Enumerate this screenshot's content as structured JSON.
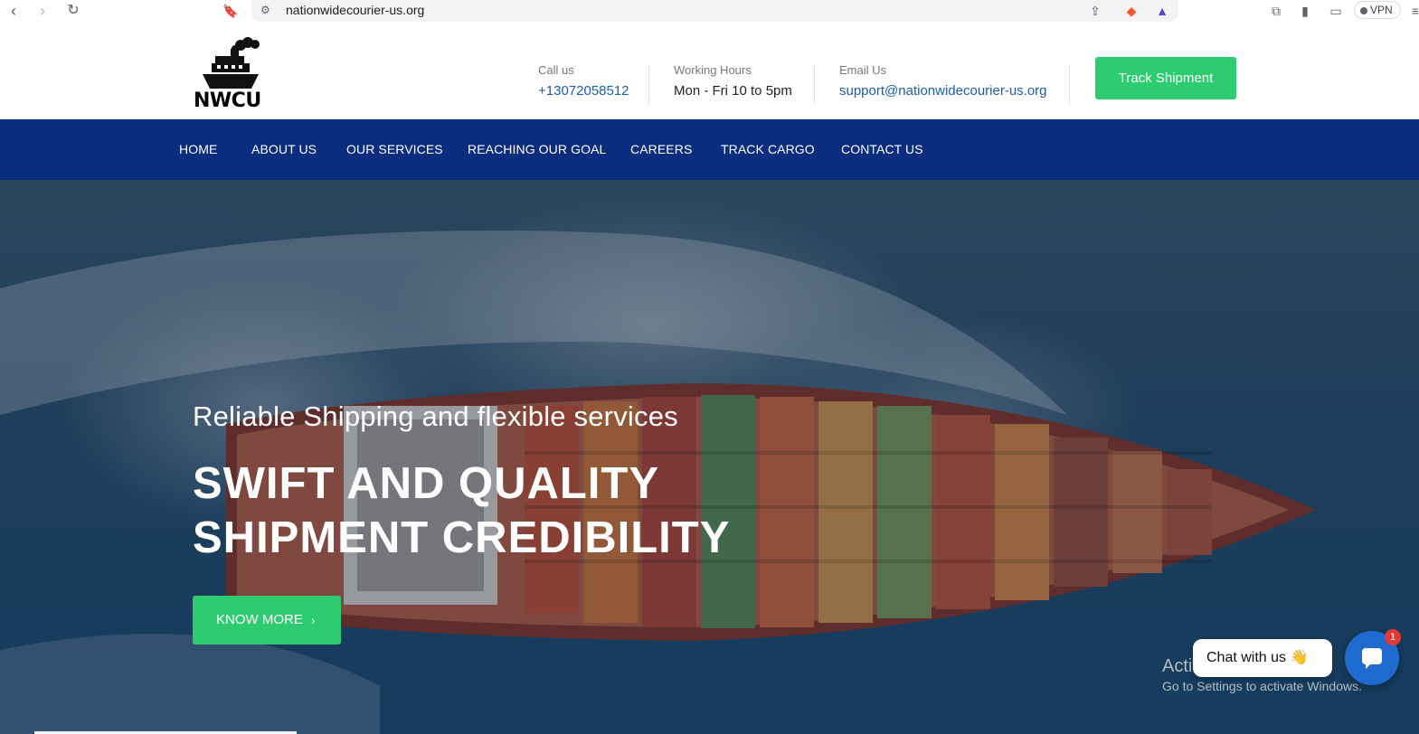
{
  "browser": {
    "url": "nationwidecourier-us.org",
    "vpn_label": "VPN"
  },
  "header": {
    "logo_text": "NWCU",
    "call": {
      "label": "Call us",
      "value": "+13072058512"
    },
    "hours": {
      "label": "Working Hours",
      "value": "Mon - Fri 10 to 5pm"
    },
    "email": {
      "label": "Email Us",
      "value": "support@nationwidecourier-us.org"
    },
    "track_button": "Track Shipment"
  },
  "nav": {
    "items": [
      "HOME",
      "ABOUT US",
      "OUR SERVICES",
      "REACHING OUR GOAL",
      "CAREERS",
      "TRACK CARGO",
      "CONTACT US"
    ]
  },
  "hero": {
    "tagline": "Reliable Shipping and flexible services",
    "headline": "SWIFT AND QUALITY SHIPMENT CREDIBILITY",
    "cta": "KNOW MORE"
  },
  "os_watermark": {
    "title": "Activate Windows",
    "subtitle": "Go to Settings to activate Windows."
  },
  "chat": {
    "bubble_text": "Chat with us 👋",
    "badge_count": "1"
  },
  "colors": {
    "nav_bg": "#0a2d80",
    "accent_green": "#2ecc71",
    "link_blue": "#1a5ea8"
  }
}
